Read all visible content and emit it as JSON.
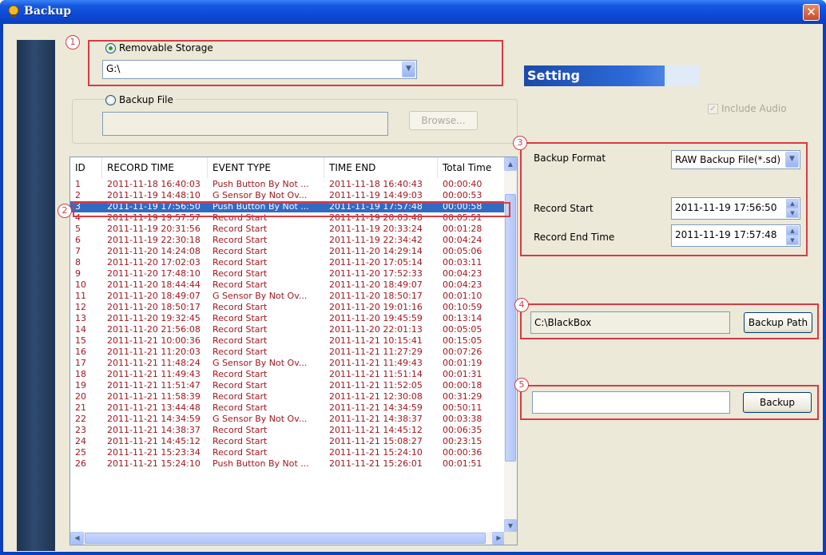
{
  "window": {
    "title": "Backup",
    "close_glyph": "✕"
  },
  "badges": {
    "b1": "1",
    "b2": "2",
    "b3": "3",
    "b4": "4",
    "b5": "5"
  },
  "source": {
    "removable_label": "Removable Storage",
    "removable_selected": true,
    "drive_value": "G:\\",
    "backup_file_label": "Backup File",
    "backup_file_value": "",
    "browse_label": "Browse..."
  },
  "setting": {
    "title": "Setting",
    "include_audio_label": "Include Audio",
    "include_audio_checked": true,
    "backup_format_label": "Backup Format",
    "backup_format_value": "RAW Backup File(*.sd)",
    "record_start_label": "Record Start",
    "record_start_value": "2011-11-19 17:56:50",
    "record_end_label": "Record End Time",
    "record_end_value": "2011-11-19 17:57:48"
  },
  "path": {
    "value": "C:\\BlackBox",
    "button_label": "Backup Path"
  },
  "backup": {
    "progress_value": "",
    "button_label": "Backup"
  },
  "table": {
    "columns": [
      "ID",
      "RECORD TIME",
      "EVENT TYPE",
      "TIME END",
      "Total Time"
    ],
    "selected_index": 2,
    "rows": [
      [
        "1",
        "2011-11-18 16:40:03",
        "Push Button By Not ...",
        "2011-11-18 16:40:43",
        "00:00:40"
      ],
      [
        "2",
        "2011-11-19 14:48:10",
        "G Sensor By Not Ov...",
        "2011-11-19 14:49:03",
        "00:00:53"
      ],
      [
        "3",
        "2011-11-19 17:56:50",
        "Push Button By Not ...",
        "2011-11-19 17:57:48",
        "00:00:58"
      ],
      [
        "4",
        "2011-11-19 19:57:57",
        "Record Start",
        "2011-11-19 20:03:48",
        "00:05:51"
      ],
      [
        "5",
        "2011-11-19 20:31:56",
        "Record Start",
        "2011-11-19 20:33:24",
        "00:01:28"
      ],
      [
        "6",
        "2011-11-19 22:30:18",
        "Record Start",
        "2011-11-19 22:34:42",
        "00:04:24"
      ],
      [
        "7",
        "2011-11-20 14:24:08",
        "Record Start",
        "2011-11-20 14:29:14",
        "00:05:06"
      ],
      [
        "8",
        "2011-11-20 17:02:03",
        "Record Start",
        "2011-11-20 17:05:14",
        "00:03:11"
      ],
      [
        "9",
        "2011-11-20 17:48:10",
        "Record Start",
        "2011-11-20 17:52:33",
        "00:04:23"
      ],
      [
        "10",
        "2011-11-20 18:44:44",
        "Record Start",
        "2011-11-20 18:49:07",
        "00:04:23"
      ],
      [
        "11",
        "2011-11-20 18:49:07",
        "G Sensor By Not Ov...",
        "2011-11-20 18:50:17",
        "00:01:10"
      ],
      [
        "12",
        "2011-11-20 18:50:17",
        "Record Start",
        "2011-11-20 19:01:16",
        "00:10:59"
      ],
      [
        "13",
        "2011-11-20 19:32:45",
        "Record Start",
        "2011-11-20 19:45:59",
        "00:13:14"
      ],
      [
        "14",
        "2011-11-20 21:56:08",
        "Record Start",
        "2011-11-20 22:01:13",
        "00:05:05"
      ],
      [
        "15",
        "2011-11-21 10:00:36",
        "Record Start",
        "2011-11-21 10:15:41",
        "00:15:05"
      ],
      [
        "16",
        "2011-11-21 11:20:03",
        "Record Start",
        "2011-11-21 11:27:29",
        "00:07:26"
      ],
      [
        "17",
        "2011-11-21 11:48:24",
        "G Sensor By Not Ov...",
        "2011-11-21 11:49:43",
        "00:01:19"
      ],
      [
        "18",
        "2011-11-21 11:49:43",
        "Record Start",
        "2011-11-21 11:51:14",
        "00:01:31"
      ],
      [
        "19",
        "2011-11-21 11:51:47",
        "Record Start",
        "2011-11-21 11:52:05",
        "00:00:18"
      ],
      [
        "20",
        "2011-11-21 11:58:39",
        "Record Start",
        "2011-11-21 12:30:08",
        "00:31:29"
      ],
      [
        "21",
        "2011-11-21 13:44:48",
        "Record Start",
        "2011-11-21 14:34:59",
        "00:50:11"
      ],
      [
        "22",
        "2011-11-21 14:34:59",
        "G Sensor By Not Ov...",
        "2011-11-21 14:38:37",
        "00:03:38"
      ],
      [
        "23",
        "2011-11-21 14:38:37",
        "Record Start",
        "2011-11-21 14:45:12",
        "00:06:35"
      ],
      [
        "24",
        "2011-11-21 14:45:12",
        "Record Start",
        "2011-11-21 15:08:27",
        "00:23:15"
      ],
      [
        "25",
        "2011-11-21 15:23:34",
        "Record Start",
        "2011-11-21 15:24:10",
        "00:00:36"
      ],
      [
        "26",
        "2011-11-21 15:24:10",
        "Push Button By Not ...",
        "2011-11-21 15:26:01",
        "00:01:51"
      ]
    ]
  },
  "icons": {
    "app": "lightbulb-icon",
    "close": "close-icon",
    "dropdown": "chevron-down-icon",
    "spin": "spin-arrows-icon",
    "scroll": "scroll-arrow-icon"
  },
  "colors": {
    "title_bar": "#0a3fbd",
    "highlight_box": "#d83a44",
    "selection": "#316ac5",
    "row_text": "#a01820"
  }
}
